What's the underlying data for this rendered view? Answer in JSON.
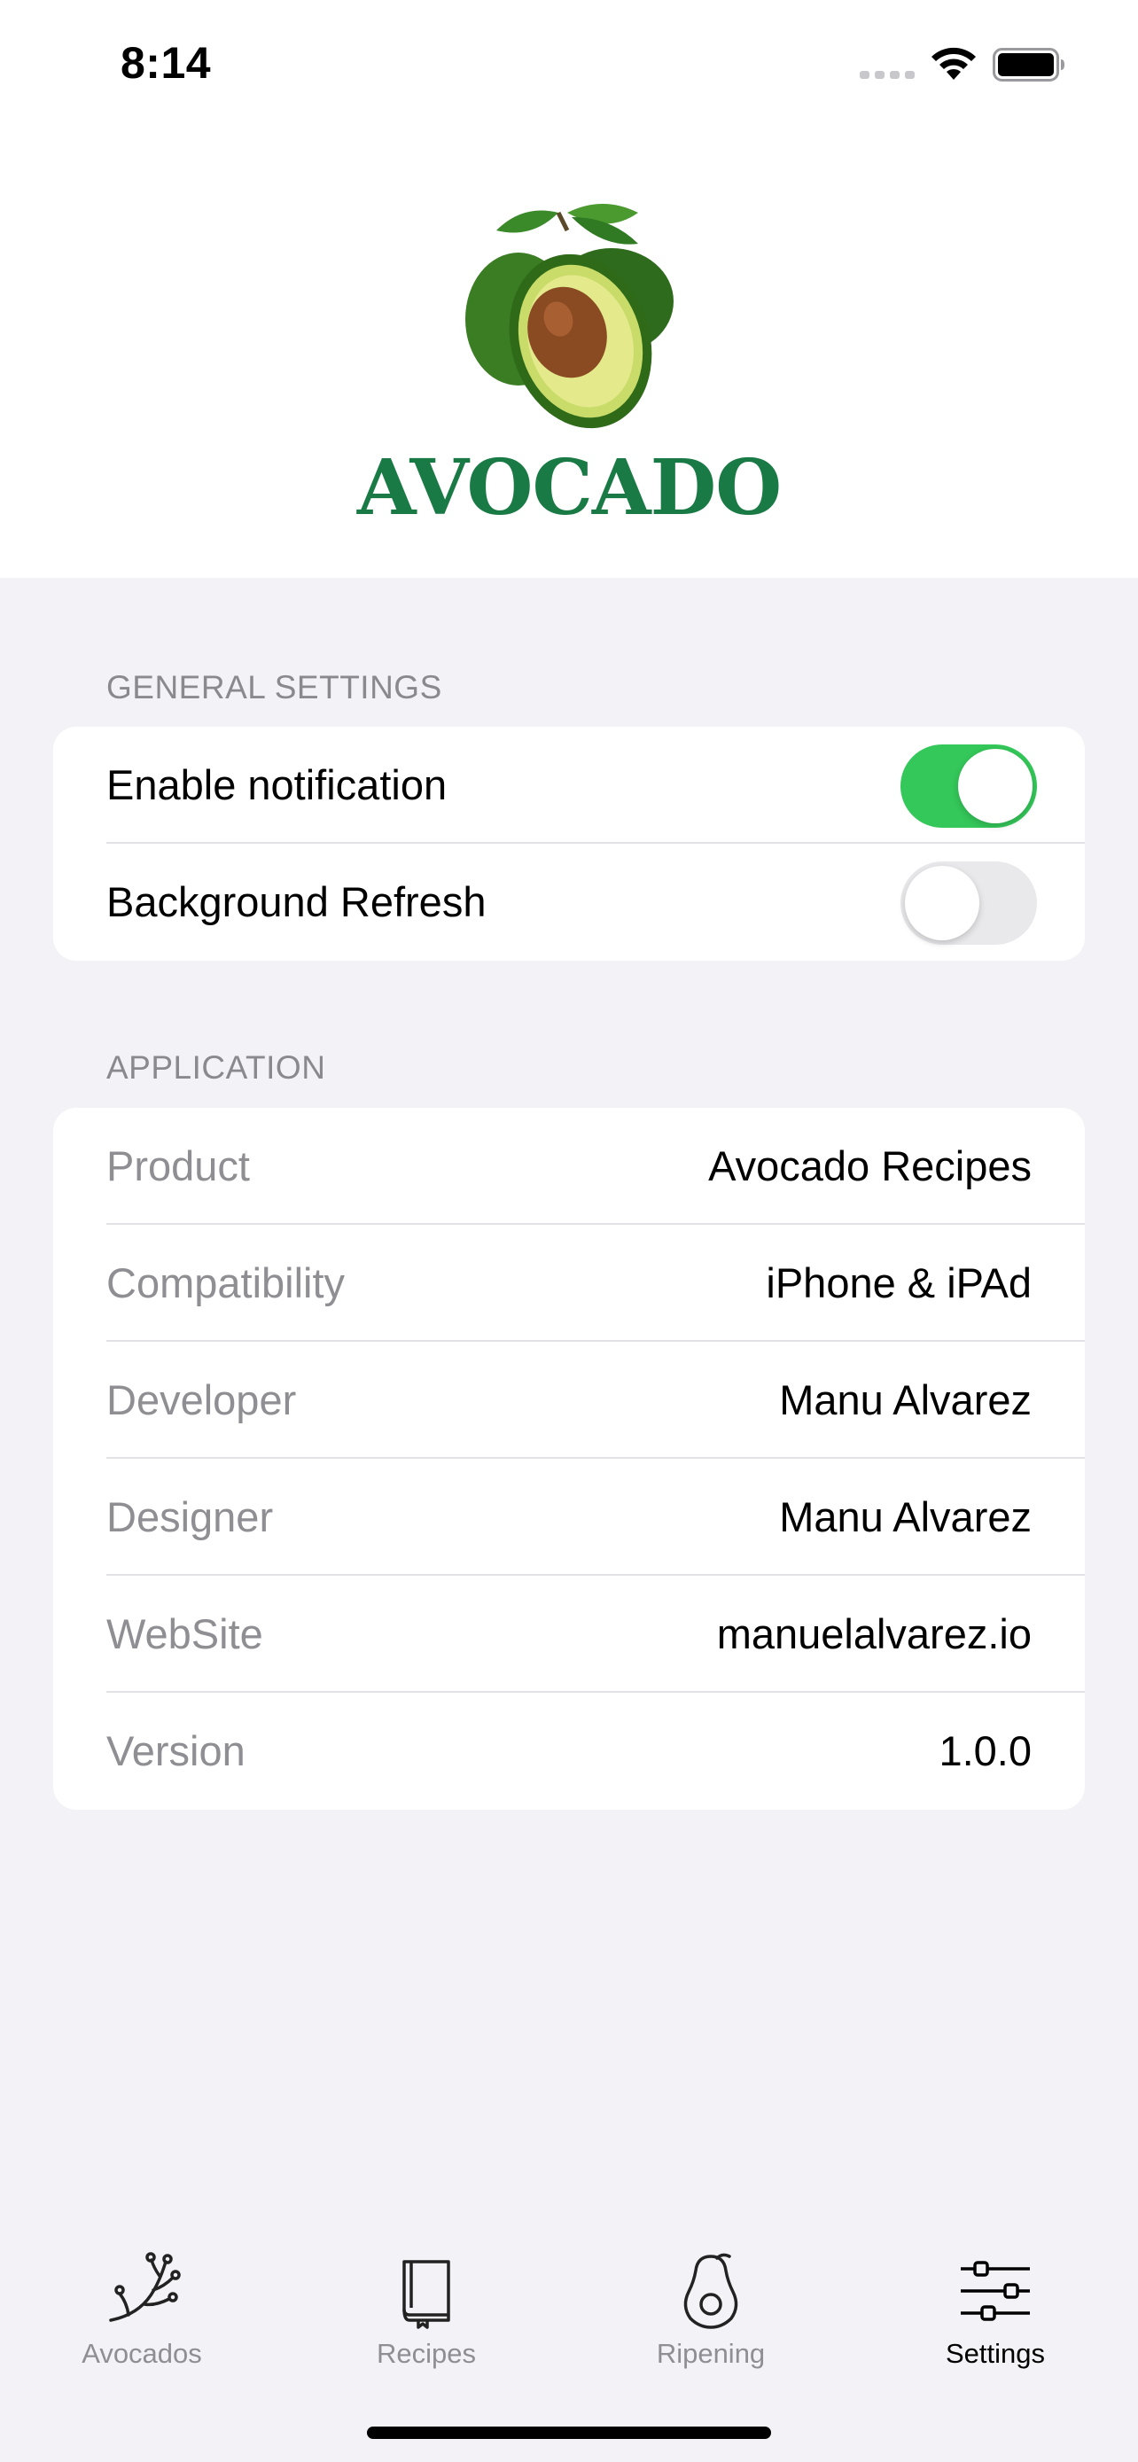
{
  "status_bar": {
    "time": "8:14"
  },
  "header": {
    "logo_text": "AVOCADO"
  },
  "general_settings": {
    "title": "GENERAL SETTINGS",
    "rows": [
      {
        "label": "Enable notification",
        "on": true
      },
      {
        "label": "Background Refresh",
        "on": false
      }
    ]
  },
  "application": {
    "title": "APPLICATION",
    "rows": [
      {
        "label": "Product",
        "value": "Avocado Recipes"
      },
      {
        "label": "Compatibility",
        "value": "iPhone & iPAd"
      },
      {
        "label": "Developer",
        "value": "Manu Alvarez"
      },
      {
        "label": "Designer",
        "value": "Manu Alvarez"
      },
      {
        "label": "WebSite",
        "value": "manuelalvarez.io"
      },
      {
        "label": "Version",
        "value": "1.0.0"
      }
    ]
  },
  "tabbar": {
    "tabs": [
      {
        "label": "Avocados",
        "icon": "branch-icon"
      },
      {
        "label": "Recipes",
        "icon": "book-icon"
      },
      {
        "label": "Ripening",
        "icon": "avocado-icon"
      },
      {
        "label": "Settings",
        "icon": "sliders-icon",
        "active": true
      }
    ]
  },
  "colors": {
    "accent_green": "#34c759",
    "brand_green": "#1a7a45"
  }
}
